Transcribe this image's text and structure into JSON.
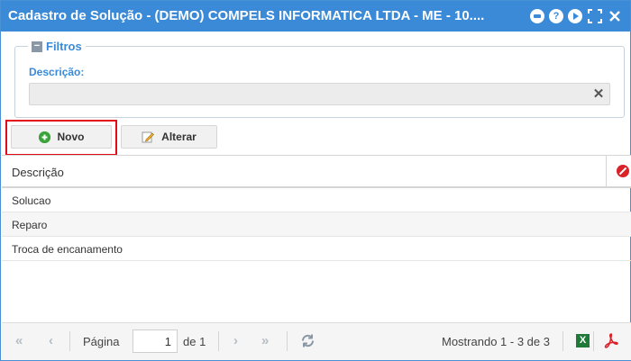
{
  "window": {
    "title": "Cadastro de Solução - (DEMO) COMPELS INFORMATICA LTDA - ME - 10....",
    "icons": [
      "minimize-icon",
      "help-icon",
      "play-icon",
      "fullscreen-icon",
      "close-icon"
    ]
  },
  "filters": {
    "legend": "Filtros",
    "description_label": "Descrição:",
    "description_value": "",
    "description_placeholder": ""
  },
  "toolbar": {
    "new_label": "Novo",
    "edit_label": "Alterar"
  },
  "grid": {
    "column_header": "Descrição",
    "rows": [
      {
        "description": "Solucao"
      },
      {
        "description": "Reparo"
      },
      {
        "description": "Troca de encanamento"
      }
    ]
  },
  "pager": {
    "page_label": "Página",
    "current_page": "1",
    "of_label": "de 1",
    "showing": "Mostrando 1 - 3 de 3"
  },
  "colors": {
    "titlebar": "#3a8ad8",
    "accent_text": "#3a8ad8",
    "highlight_border": "#e10c18",
    "excel_green": "#1f7a3a",
    "pdf_red": "#d9222a"
  }
}
